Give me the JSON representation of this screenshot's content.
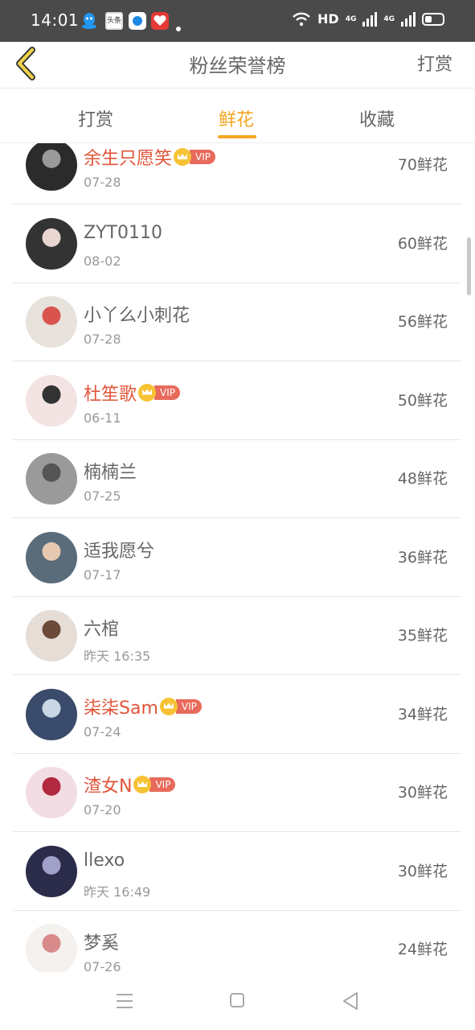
{
  "status_bar": {
    "time": "14:01",
    "app_toutiao": "头条",
    "network": "HD",
    "net_4g_1": "4G",
    "net_4g_2": "4G"
  },
  "header": {
    "title": "粉丝荣誉榜",
    "action": "打赏",
    "back_icon": "chevron-left-icon"
  },
  "tabs": [
    {
      "label": "打赏",
      "active": false
    },
    {
      "label": "鲜花",
      "active": true
    },
    {
      "label": "收藏",
      "active": false
    }
  ],
  "vip_label": "VIP",
  "colors": {
    "accent": "#f5a623",
    "vip_name": "#e0553a",
    "vip_badge": "#e86a5b",
    "crown": "#f7c233"
  },
  "fans": [
    {
      "name": "余生只愿笑",
      "date": "07-28",
      "count": "70鲜花",
      "vip": true
    },
    {
      "name": "ZYT0110",
      "date": "08-02",
      "count": "60鲜花",
      "vip": false
    },
    {
      "name": "小丫么小刺花",
      "date": "07-28",
      "count": "56鲜花",
      "vip": false
    },
    {
      "name": "杜笙歌",
      "date": "06-11",
      "count": "50鲜花",
      "vip": true
    },
    {
      "name": "楠楠兰",
      "date": "07-25",
      "count": "48鲜花",
      "vip": false
    },
    {
      "name": "适我愿兮",
      "date": "07-17",
      "count": "36鲜花",
      "vip": false
    },
    {
      "name": "六棺",
      "date": "昨天 16:35",
      "count": "35鲜花",
      "vip": false
    },
    {
      "name": "柒柒Sam",
      "date": "07-24",
      "count": "34鲜花",
      "vip": true
    },
    {
      "name": "渣女N",
      "date": "07-20",
      "count": "30鲜花",
      "vip": true
    },
    {
      "name": "llexo",
      "date": "昨天 16:49",
      "count": "30鲜花",
      "vip": false
    },
    {
      "name": "梦奚",
      "date": "07-26",
      "count": "24鲜花",
      "vip": false
    }
  ]
}
